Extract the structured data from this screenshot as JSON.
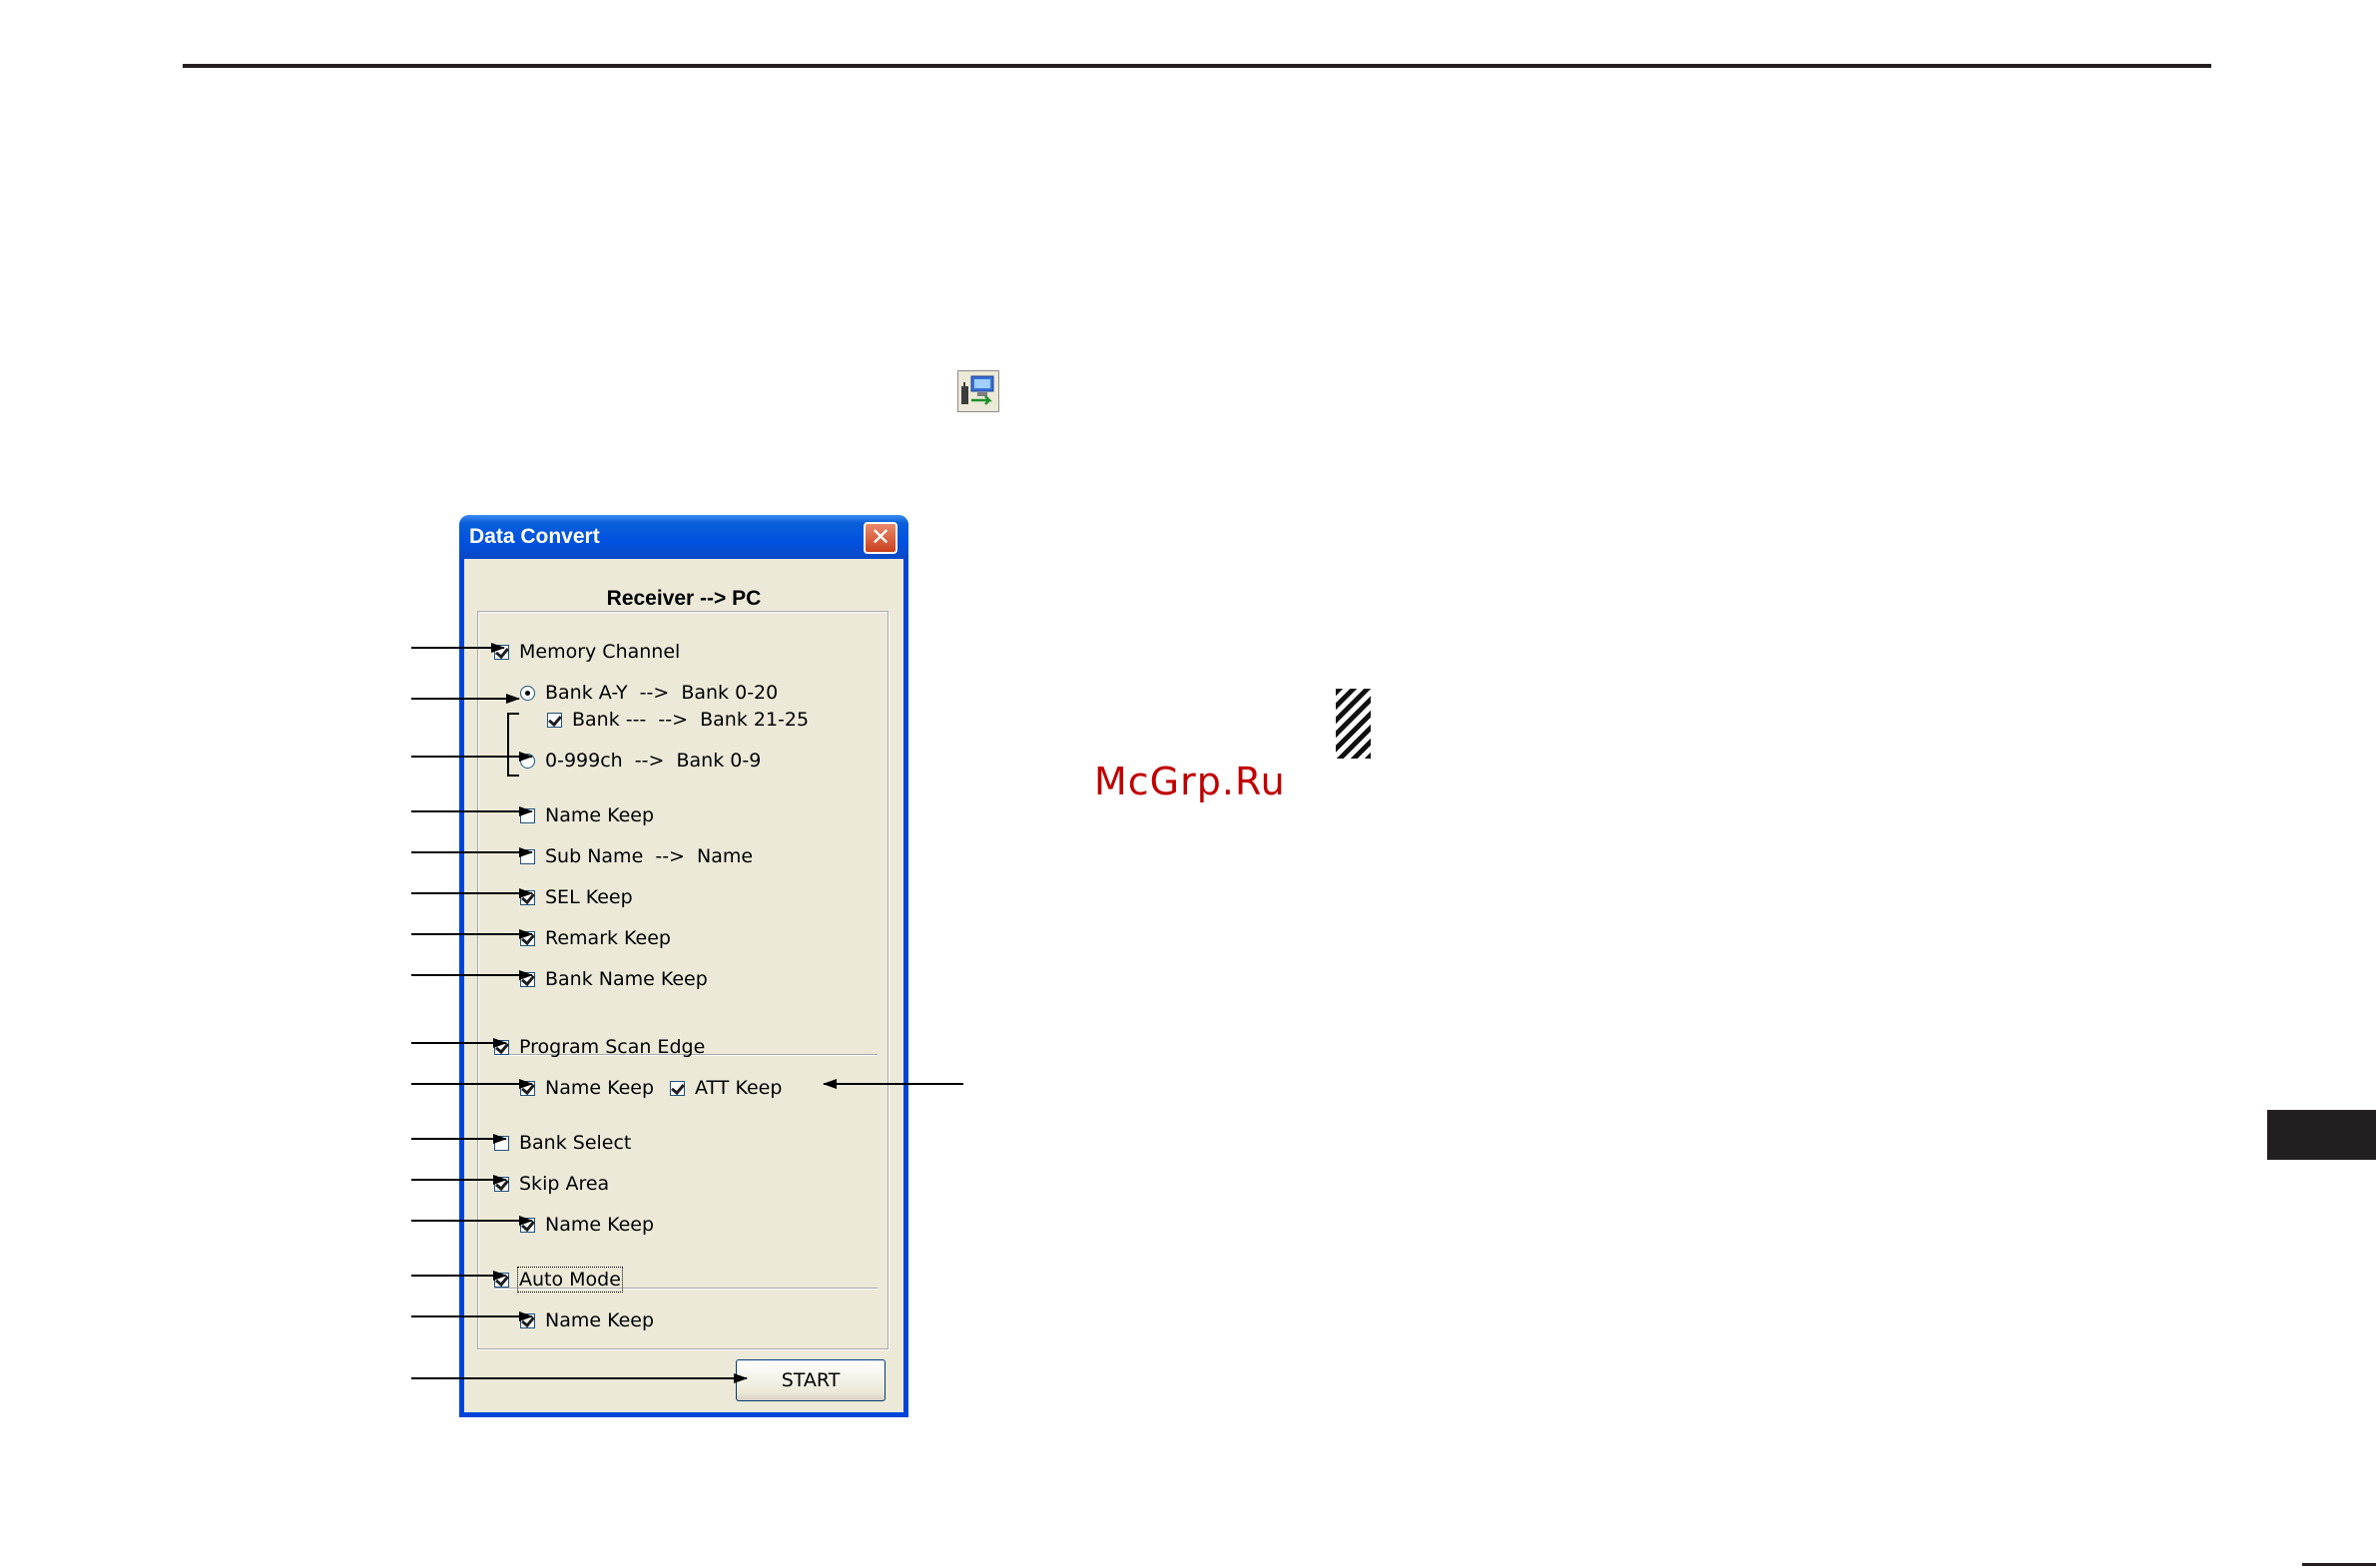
{
  "watermark": "McGrp.Ru",
  "dialog": {
    "title": "Data Convert",
    "close_label": "✕",
    "subtitle": "Receiver --> PC",
    "start_label": "START"
  },
  "options": [
    {
      "type": "checkbox",
      "label": "Memory Channel",
      "checked": true
    },
    {
      "type": "radio",
      "label": "Bank A-Y  -->  Bank 0-20",
      "checked": true
    },
    {
      "type": "checkbox",
      "label": "Bank ---  -->  Bank 21-25",
      "checked": true
    },
    {
      "type": "radio",
      "label": "0-999ch  -->  Bank 0-9",
      "checked": false
    },
    {
      "type": "checkbox",
      "label": "Name Keep",
      "checked": false
    },
    {
      "type": "checkbox",
      "label": "Sub Name  -->  Name",
      "checked": false
    },
    {
      "type": "checkbox",
      "label": "SEL Keep",
      "checked": true
    },
    {
      "type": "checkbox",
      "label": "Remark Keep",
      "checked": true
    },
    {
      "type": "checkbox",
      "label": "Bank Name Keep",
      "checked": true
    },
    {
      "type": "checkbox",
      "label": "Program Scan Edge",
      "checked": true
    },
    {
      "type": "checkbox",
      "label": "Name Keep",
      "checked": true
    },
    {
      "type": "checkbox",
      "label": "ATT Keep",
      "checked": true
    },
    {
      "type": "checkbox",
      "label": "Bank Select",
      "checked": false
    },
    {
      "type": "checkbox",
      "label": "Skip Area",
      "checked": true
    },
    {
      "type": "checkbox",
      "label": "Name Keep",
      "checked": true
    },
    {
      "type": "checkbox",
      "label": "Auto Mode",
      "checked": true,
      "focused": true
    },
    {
      "type": "checkbox",
      "label": "Name Keep",
      "checked": true
    }
  ],
  "colors": {
    "titlebar": "#0052e0",
    "client": "#ece9d8",
    "close_button": "#d9582f",
    "watermark": "#c00000"
  },
  "icons": [
    "transfer-icon",
    "close-icon",
    "checkbox-checked-icon",
    "radio-icon"
  ]
}
